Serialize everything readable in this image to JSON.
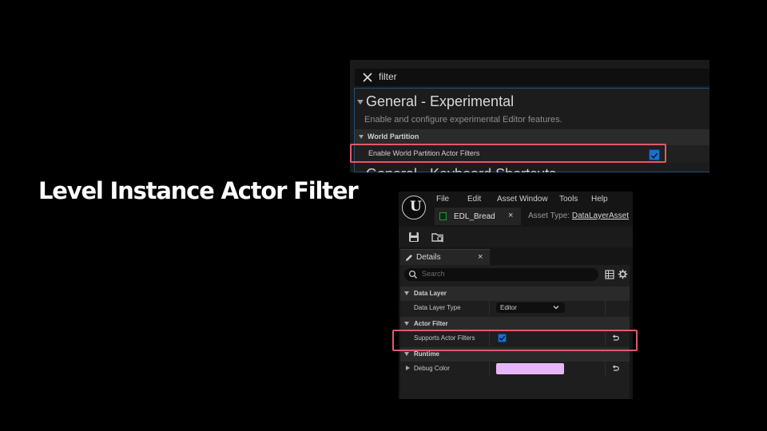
{
  "slide": {
    "title": "Level Instance Actor Filter"
  },
  "preferences": {
    "search_value": "filter",
    "section_title": "General - Experimental",
    "section_description": "Enable and configure experimental Editor features.",
    "category": "World Partition",
    "property_label": "Enable World Partition Actor Filters",
    "property_checked": true,
    "next_section_title": "General - Keyboard Shortcuts"
  },
  "editor": {
    "menu": [
      "File",
      "Edit",
      "Asset",
      "Window",
      "Tools",
      "Help"
    ],
    "asset_tab_name": "EDL_Bread",
    "asset_tab_close": "×",
    "asset_type_label": "Asset Type:",
    "asset_type_value": "DataLayerAsset",
    "details_tab_label": "Details",
    "details_tab_close": "×",
    "search_placeholder": "Search",
    "rows": {
      "data_layer_category": "Data Layer",
      "data_layer_type_label": "Data Layer Type",
      "data_layer_type_value": "Editor",
      "actor_filter_category": "Actor Filter",
      "supports_actor_filters_label": "Supports Actor Filters",
      "supports_actor_filters_checked": true,
      "runtime_category": "Runtime",
      "debug_color_label": "Debug Color",
      "debug_color_value": "#e7b6f7"
    }
  },
  "colors": {
    "highlight": "#e05a69",
    "checkbox": "#1b6fd1",
    "background": "#000000"
  }
}
